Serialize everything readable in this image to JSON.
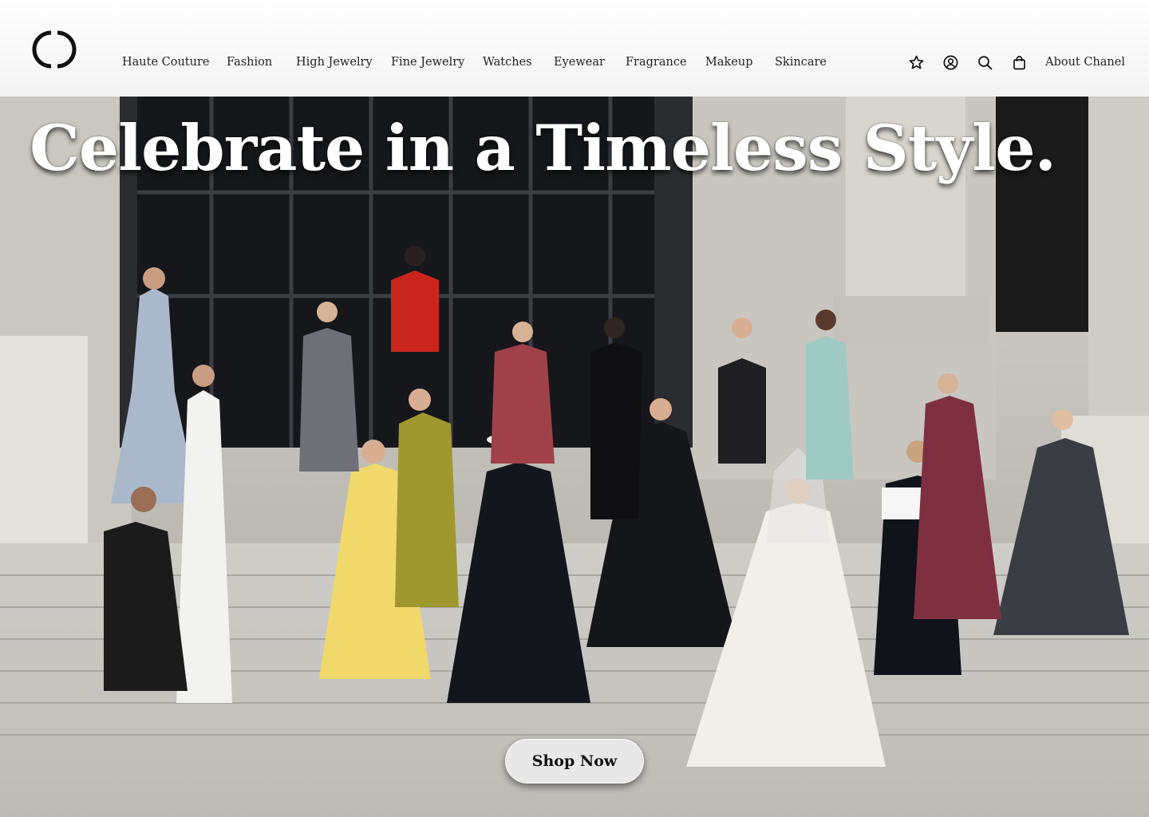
{
  "brand": {
    "logo_icon": "interlocking-c-logo-icon"
  },
  "nav": {
    "items": [
      {
        "label": "Haute Couture"
      },
      {
        "label": "Fashion"
      },
      {
        "label": "High Jewelry"
      },
      {
        "label": "Fine Jewelry"
      },
      {
        "label": "Watches"
      },
      {
        "label": "Eyewear"
      },
      {
        "label": "Fragrance"
      },
      {
        "label": "Makeup"
      },
      {
        "label": "Skincare"
      }
    ]
  },
  "tools": {
    "icons": [
      "star-icon",
      "account-icon",
      "search-icon",
      "shopping-bag-icon"
    ],
    "about_label": "About Chanel"
  },
  "hero": {
    "headline": "Celebrate in a Timeless Style.",
    "cta_label": "Shop Now",
    "image_icon": "runway-photo"
  },
  "colors": {
    "header_bg": "#ffffff",
    "text": "#111111",
    "button_bg": "#e8e8e8"
  }
}
